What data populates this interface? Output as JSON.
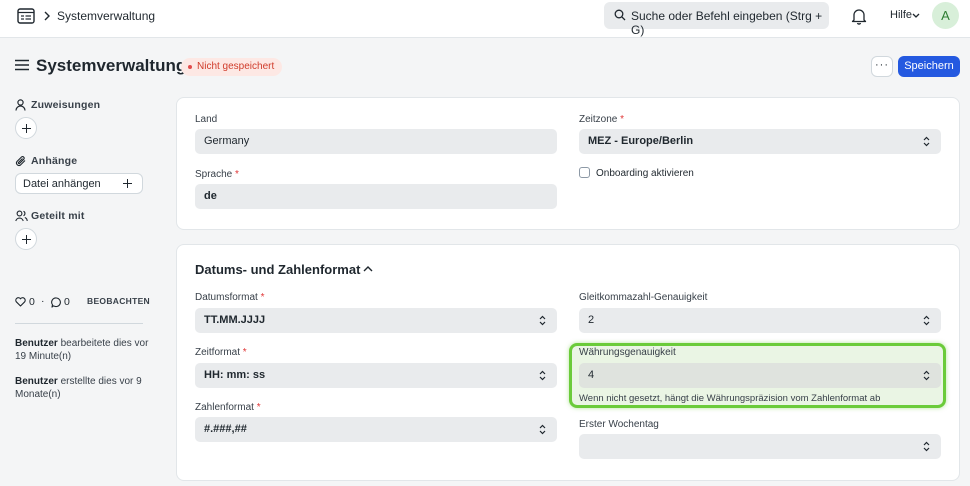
{
  "navbar": {
    "breadcrumb": "Systemverwaltung",
    "search_placeholder": "Suche oder Befehl eingeben (Strg + G)",
    "help_label": "Hilfe",
    "avatar_initial": "A"
  },
  "page": {
    "title": "Systemverwaltung",
    "indicator": "Nicht gespeichert",
    "more_label": "···",
    "save_label": "Speichern"
  },
  "sidebar": {
    "assignments_label": "Zuweisungen",
    "attachments_label": "Anhänge",
    "attach_button": "Datei anhängen",
    "shared_label": "Geteilt mit",
    "likes_count": "0",
    "separator": "·",
    "comments_count": "0",
    "follow_label": "BEOBACHTEN",
    "activity": [
      {
        "user": "Benutzer",
        "text": " bearbeitete dies vor 19 Minute(n)"
      },
      {
        "user": "Benutzer",
        "text": " erstellte dies vor 9 Monate(n)"
      }
    ]
  },
  "form": {
    "country": {
      "label": "Land",
      "value": "Germany"
    },
    "timezone": {
      "label": "Zeitzone",
      "value": "MEZ - Europe/Berlin"
    },
    "language": {
      "label": "Sprache",
      "value": "de"
    },
    "onboarding": {
      "label": "Onboarding aktivieren",
      "checked": false
    },
    "section_title": "Datums- und Zahlenformat",
    "date_format": {
      "label": "Datumsformat",
      "value": "TT.MM.JJJJ"
    },
    "float_precision": {
      "label": "Gleitkommazahl-Genauigkeit",
      "value": "2"
    },
    "time_format": {
      "label": "Zeitformat",
      "value": "HH: mm: ss"
    },
    "currency_precision": {
      "label": "Währungsgenauigkeit",
      "value": "4",
      "help": "Wenn nicht gesetzt, hängt die Währungspräzision vom Zahlenformat ab"
    },
    "number_format": {
      "label": "Zahlenformat",
      "value": "#.###,##"
    },
    "first_day_of_week": {
      "label": "Erster Wochentag",
      "value": ""
    },
    "required_mark": "*"
  },
  "colors": {
    "primary": "#2459e0",
    "highlight": "#6bcb3a",
    "unsaved": "#d03c2b"
  }
}
